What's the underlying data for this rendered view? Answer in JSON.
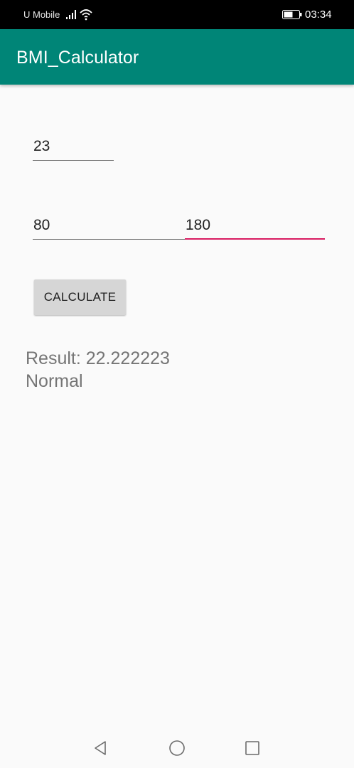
{
  "status_bar": {
    "carrier": "U Mobile",
    "time": "03:34",
    "icons": [
      "signal-icon",
      "wifi-icon",
      "battery-icon"
    ]
  },
  "app_bar": {
    "title": "BMI_Calculator",
    "color": "#008577"
  },
  "form": {
    "age_value": "23",
    "weight_value": "80",
    "height_value": "180",
    "focus_accent": "#d81b60"
  },
  "button": {
    "calculate_label": "CALCULATE"
  },
  "result": {
    "value_text": "Result: 22.222223",
    "category_text": "Normal"
  },
  "nav_bar": {
    "icons": [
      "back-icon",
      "home-icon",
      "recent-apps-icon"
    ]
  }
}
